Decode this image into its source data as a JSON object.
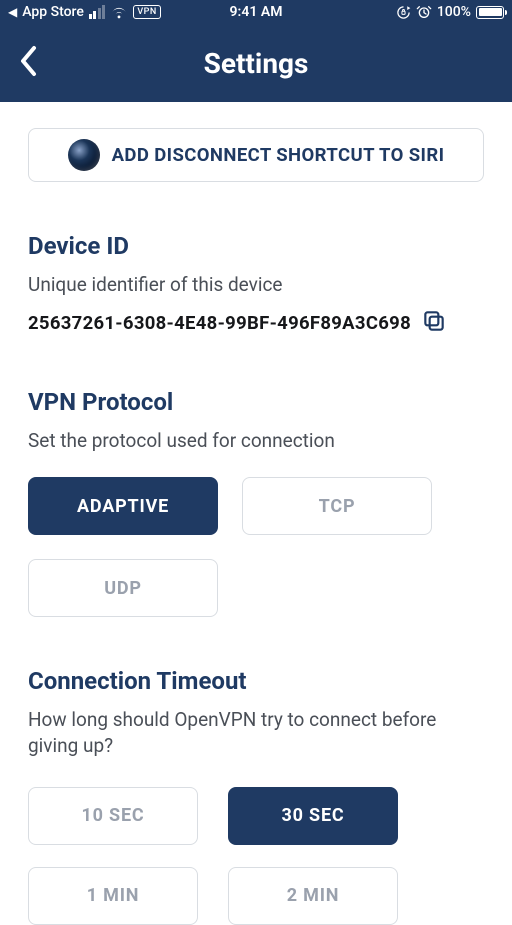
{
  "status_bar": {
    "back_app": "App Store",
    "vpn_badge": "VPN",
    "time": "9:41 AM",
    "battery_pct": "100%"
  },
  "nav": {
    "title": "Settings"
  },
  "siri": {
    "label": "ADD DISCONNECT SHORTCUT TO SIRI"
  },
  "device_id": {
    "title": "Device ID",
    "desc": "Unique identifier of this device",
    "value": "25637261-6308-4E48-99BF-496F89A3C698"
  },
  "vpn_protocol": {
    "title": "VPN Protocol",
    "desc": "Set the protocol used for connection",
    "options": [
      {
        "label": "ADAPTIVE",
        "selected": true
      },
      {
        "label": "TCP",
        "selected": false
      },
      {
        "label": "UDP",
        "selected": false
      }
    ]
  },
  "timeout": {
    "title": "Connection Timeout",
    "desc": "How long should OpenVPN try to connect before giving up?",
    "options": [
      {
        "label": "10 SEC",
        "selected": false
      },
      {
        "label": "30 SEC",
        "selected": true
      },
      {
        "label": "1 MIN",
        "selected": false
      },
      {
        "label": "2 MIN",
        "selected": false
      }
    ]
  }
}
